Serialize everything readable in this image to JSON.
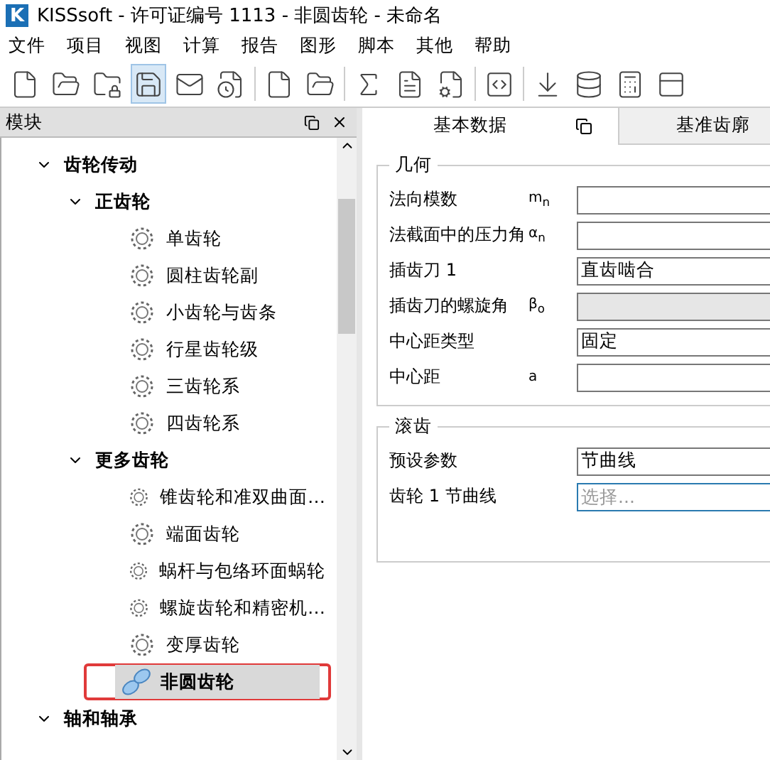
{
  "window": {
    "logo": "K",
    "title": "KISSsoft - 许可证编号 1113 - 非圆齿轮 - 未命名"
  },
  "menu": [
    "文件",
    "项目",
    "视图",
    "计算",
    "报告",
    "图形",
    "脚本",
    "其他",
    "帮助"
  ],
  "module_panel": {
    "title": "模块",
    "tree": [
      {
        "label": "齿轮传动",
        "expanded": true,
        "children": [
          {
            "label": "正齿轮",
            "expanded": true,
            "children": [
              {
                "label": "单齿轮",
                "selected": false
              },
              {
                "label": "圆柱齿轮副",
                "selected": false
              },
              {
                "label": "小齿轮与齿条",
                "selected": false
              },
              {
                "label": "行星齿轮级",
                "selected": false
              },
              {
                "label": "三齿轮系",
                "selected": false
              },
              {
                "label": "四齿轮系",
                "selected": false
              }
            ]
          },
          {
            "label": "更多齿轮",
            "expanded": true,
            "children": [
              {
                "label": "锥齿轮和准双曲面…",
                "selected": false
              },
              {
                "label": "端面齿轮",
                "selected": false
              },
              {
                "label": "蜗杆与包络环面蜗轮",
                "selected": false
              },
              {
                "label": "螺旋齿轮和精密机…",
                "selected": false
              },
              {
                "label": "变厚齿轮",
                "selected": false
              },
              {
                "label": "非圆齿轮",
                "selected": true,
                "marked": true
              }
            ]
          }
        ]
      },
      {
        "label": "轴和轴承",
        "expanded": true
      }
    ]
  },
  "tabs": [
    {
      "label": "基本数据",
      "selected": true
    },
    {
      "label": "基准齿廓",
      "selected": false
    }
  ],
  "groups": [
    {
      "title": "几何",
      "rows": [
        {
          "label": "法向模数",
          "symbol": "m$_{n}$",
          "value": "",
          "disabled": false
        },
        {
          "label": "法截面中的压力角",
          "symbol": "α$_{n}$",
          "value": "",
          "disabled": false
        },
        {
          "label": "插齿刀 1",
          "value": "直齿啮合",
          "disabled": false
        },
        {
          "label": "插齿刀的螺旋角",
          "symbol": "β$_{o}$",
          "value": "",
          "disabled": true
        },
        {
          "label": "中心距类型",
          "value": "固定",
          "disabled": false
        },
        {
          "label": "中心距",
          "symbol": "a",
          "value": "",
          "disabled": false
        }
      ]
    },
    {
      "title": "滚齿",
      "rows": [
        {
          "label": "预设参数",
          "value": "节曲线",
          "disabled": false
        },
        {
          "label": "齿轮 1 节曲线",
          "placeholder": "选择...",
          "disabled": false,
          "focused": true
        }
      ]
    }
  ]
}
